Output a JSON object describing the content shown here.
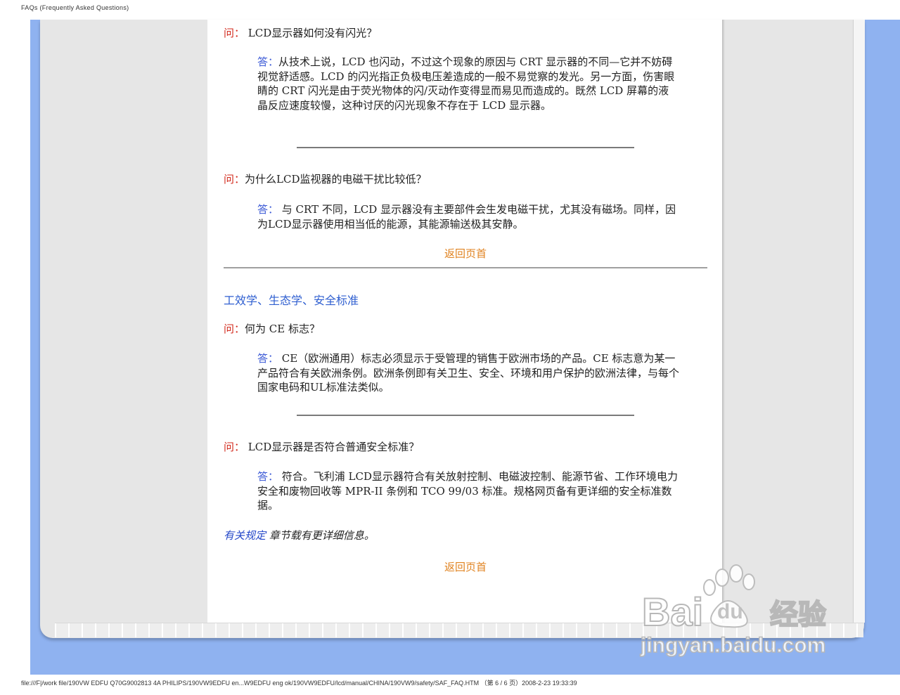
{
  "print_header": "FAQs (Frequently Asked Questions)",
  "print_footer": "file:///F|/work file/190VW EDFU Q70G9002813 4A PHILIPS/190VW9EDFU en...W9EDFU eng ok/190VW9EDFU/lcd/manual/CHINA/190VW9/safety/SAF_FAQ.HTM  （第 6 / 6 页）2008-2-23 19:33:39",
  "qa": [
    {
      "q_label": "问：",
      "question": " LCD显示器如何没有闪光？",
      "a_label": "答：",
      "answer": "从技术上说，LCD 也闪动，不过这个现象的原因与 CRT 显示器的不同—它并不妨碍视觉舒适感。LCD 的闪光指正负极电压差造成的一般不易觉察的发光。另一方面，伤害眼睛的 CRT 闪光是由于荧光物体的闪/灭动作变得显而易见而造成的。既然 LCD 屏幕的液晶反应速度较慢，这种讨厌的闪光现象不存在于 LCD 显示器。"
    },
    {
      "q_label": "问：",
      "question": "为什么LCD监视器的电磁干扰比较低？",
      "a_label": "答：",
      "answer": " 与 CRT 不同，LCD 显示器没有主要部件会生发电磁干扰，尤其没有磁场。同样，因为LCD显示器使用相当低的能源，其能源输送极其安静。"
    },
    {
      "q_label": "问：",
      "question": "何为 CE 标志？",
      "a_label": "答：",
      "answer": " CE（欧洲通用）标志必须显示于受管理的销售于欧洲市场的产品。CE 标志意为某一产品符合有关欧洲条例。欧洲条例即有关卫生、安全、环境和用户保护的欧洲法律，与每个国家电码和UL标准法类似。"
    },
    {
      "q_label": "问：",
      "question": " LCD显示器是否符合普通安全标准？",
      "a_label": "答：",
      "answer": " 符合。飞利浦 LCD显示器符合有关放射控制、电磁波控制、能源节省、工作环境电力安全和废物回收等 MPR-II 条例和 TCO 99/03 标准。规格网页备有更详细的安全标准数据。"
    }
  ],
  "back_to_top": "返回页首",
  "section_title": "工效学、生态学、安全标准",
  "note": {
    "link": "有关规定",
    "text": " 章节载有更详细信息。"
  },
  "watermark": {
    "brand": "Bai",
    "brand_du": "du",
    "brand_cn": "经验",
    "url": "jingyan.baidu.com"
  }
}
